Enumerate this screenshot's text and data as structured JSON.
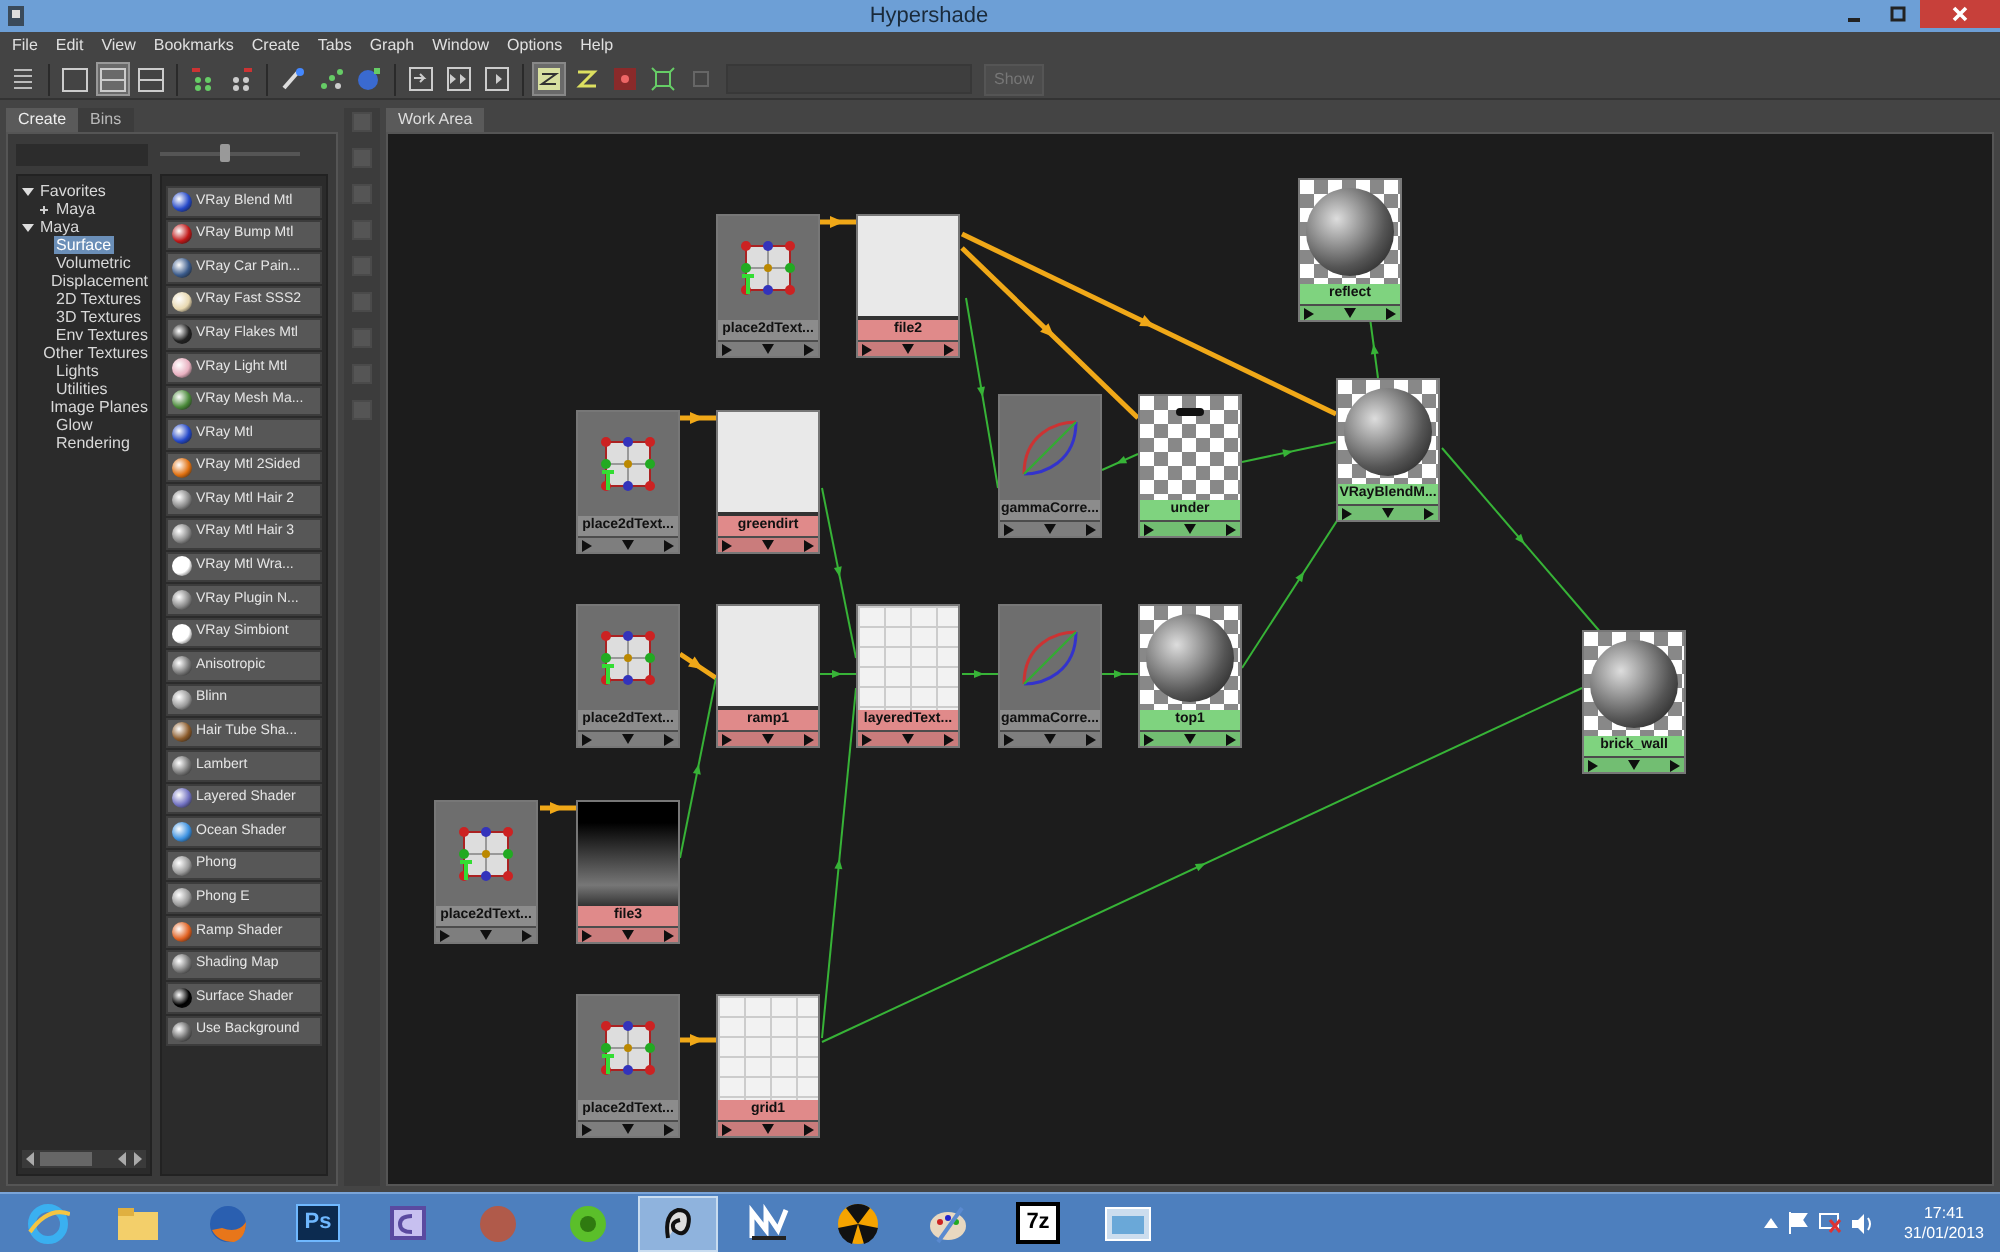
{
  "window": {
    "title": "Hypershade"
  },
  "menu": [
    "File",
    "Edit",
    "View",
    "Bookmarks",
    "Create",
    "Tabs",
    "Graph",
    "Window",
    "Options",
    "Help"
  ],
  "toolbar": {
    "layout_modes": [
      {
        "selected": false
      },
      {
        "selected": true
      },
      {
        "selected": false
      }
    ],
    "show_button": {
      "label": "Show",
      "disabled": true
    }
  },
  "left_panel": {
    "tabs": [
      {
        "label": "Create",
        "selected": true
      },
      {
        "label": "Bins",
        "selected": false
      }
    ],
    "slider": {
      "level": 0.45
    },
    "tree": [
      {
        "label": "Favorites",
        "expanded": true,
        "selected": false,
        "children": [
          {
            "label": "Maya",
            "expanded": false,
            "selected": false
          }
        ]
      },
      {
        "label": "Maya",
        "expanded": true,
        "selected": false,
        "children": [
          {
            "label": "Surface",
            "selected": true
          },
          {
            "label": "Volumetric",
            "selected": false
          },
          {
            "label": "Displacement",
            "selected": false
          },
          {
            "label": "2D Textures",
            "selected": false
          },
          {
            "label": "3D Textures",
            "selected": false
          },
          {
            "label": "Env Textures",
            "selected": false
          },
          {
            "label": "Other Textures",
            "selected": false
          },
          {
            "label": "Lights",
            "selected": false
          },
          {
            "label": "Utilities",
            "selected": false
          },
          {
            "label": "Image Planes",
            "selected": false
          },
          {
            "label": "Glow",
            "selected": false
          },
          {
            "label": "Rendering",
            "selected": false
          }
        ]
      }
    ],
    "materials": [
      "VRay Blend Mtl",
      "VRay Bump Mtl",
      "VRay Car Pain...",
      "VRay Fast SSS2",
      "VRay Flakes Mtl",
      "VRay Light Mtl",
      "VRay Mesh Ma...",
      "VRay Mtl",
      "VRay Mtl 2Sided",
      "VRay Mtl Hair 2",
      "VRay Mtl Hair 3",
      "VRay Mtl Wra...",
      "VRay Plugin N...",
      "VRay Simbiont",
      "Anisotropic",
      "Blinn",
      "Hair Tube Sha...",
      "Lambert",
      "Layered Shader",
      "Ocean Shader",
      "Phong",
      "Phong E",
      "Ramp Shader",
      "Shading Map",
      "Surface Shader",
      "Use Background"
    ]
  },
  "work_area": {
    "tabs": [
      {
        "label": "Work Area",
        "selected": true
      }
    ],
    "nodes": [
      {
        "label": "place2dText...",
        "kind": "placement"
      },
      {
        "label": "file2",
        "kind": "texture"
      },
      {
        "label": "reflect",
        "kind": "shader"
      },
      {
        "label": "place2dText...",
        "kind": "placement"
      },
      {
        "label": "greendirt",
        "kind": "texture"
      },
      {
        "label": "gammaCorre...",
        "kind": "utility"
      },
      {
        "label": "under",
        "kind": "checker"
      },
      {
        "label": "VRayBlendM...",
        "kind": "shader"
      },
      {
        "label": "place2dText...",
        "kind": "placement"
      },
      {
        "label": "ramp1",
        "kind": "texture"
      },
      {
        "label": "layeredText...",
        "kind": "grid"
      },
      {
        "label": "gammaCorre...",
        "kind": "utility"
      },
      {
        "label": "top1",
        "kind": "shader"
      },
      {
        "label": "brick_wall",
        "kind": "shader"
      },
      {
        "label": "place2dText...",
        "kind": "placement"
      },
      {
        "label": "file3",
        "kind": "dark"
      },
      {
        "label": "place2dText...",
        "kind": "placement"
      },
      {
        "label": "grid1",
        "kind": "grid"
      }
    ]
  },
  "taskbar": {
    "apps": [
      {
        "kind": "browser",
        "selected": false
      },
      {
        "kind": "folder",
        "selected": false
      },
      {
        "kind": "fox",
        "selected": false
      },
      {
        "kind": "tile",
        "label": "Ps",
        "selected": false
      },
      {
        "kind": "monitor",
        "selected": false
      },
      {
        "kind": "avatar",
        "selected": false
      },
      {
        "kind": "ball",
        "selected": false
      },
      {
        "kind": "swirl",
        "selected": true
      },
      {
        "kind": "spark",
        "selected": false
      },
      {
        "kind": "radiation",
        "selected": false
      },
      {
        "kind": "palette",
        "selected": false
      },
      {
        "kind": "tile",
        "label": "7z",
        "selected": false
      },
      {
        "kind": "window",
        "selected": false
      }
    ],
    "clock": {
      "time": "17:41",
      "date": "31/01/2013"
    }
  }
}
